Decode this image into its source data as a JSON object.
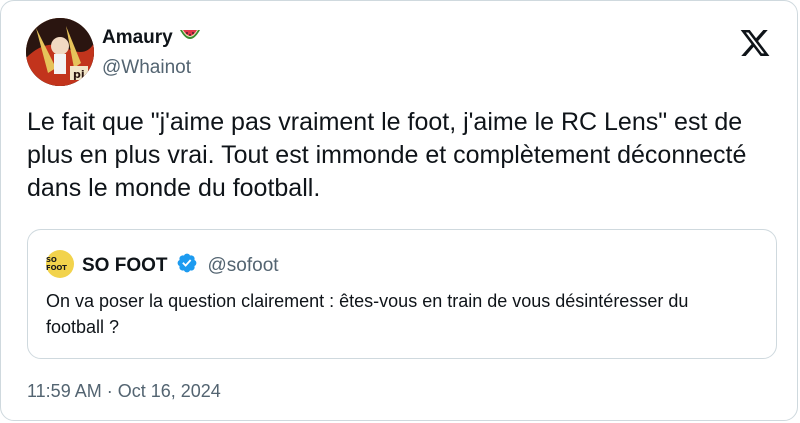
{
  "author": {
    "name": "Amaury",
    "emoji": "🍉",
    "handle": "@Whainot"
  },
  "tweet": {
    "text": "Le fait que \"j'aime pas vraiment le foot, j'aime le RC Lens\" est de plus en plus vrai. Tout est immonde et complètement déconnecté dans le monde du football."
  },
  "quote": {
    "avatar_text": "SO FOOT",
    "name": "SO FOOT",
    "handle": "@sofoot",
    "text": "On va poser la question clairement : êtes-vous en train de vous désintéresser du football ?",
    "verified_color": "#1d9bf0"
  },
  "meta": {
    "timestamp": "11:59 AM · Oct 16, 2024"
  },
  "icons": {
    "logo": "x-logo-icon",
    "verified": "verified-badge-icon"
  }
}
